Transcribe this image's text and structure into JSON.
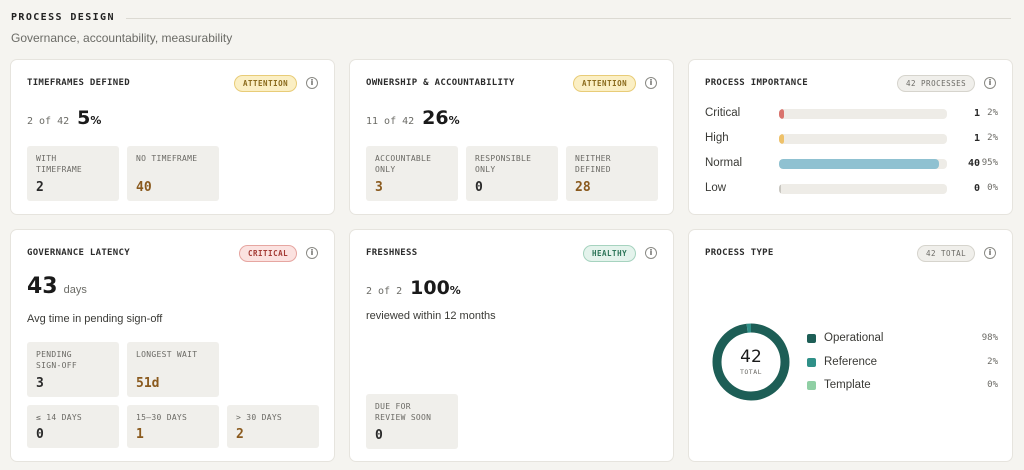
{
  "header": {
    "title": "PROCESS DESIGN",
    "subtitle": "Governance, accountability, measurability"
  },
  "timeframes": {
    "title": "TIMEFRAMES DEFINED",
    "badge": "ATTENTION",
    "count_of": "2 of 42",
    "percent": "5",
    "tiles": [
      {
        "label": "WITH\nTIMEFRAME",
        "value": "2"
      },
      {
        "label": "NO TIMEFRAME",
        "value": "40"
      }
    ]
  },
  "ownership": {
    "title": "OWNERSHIP & ACCOUNTABILITY",
    "badge": "ATTENTION",
    "count_of": "11 of 42",
    "percent": "26",
    "tiles": [
      {
        "label": "ACCOUNTABLE\nONLY",
        "value": "3"
      },
      {
        "label": "RESPONSIBLE\nONLY",
        "value": "0"
      },
      {
        "label": "NEITHER\nDEFINED",
        "value": "28"
      }
    ]
  },
  "importance": {
    "title": "PROCESS IMPORTANCE",
    "badge": "42 PROCESSES",
    "rows": [
      {
        "label": "Critical",
        "count": "1",
        "pct": "2%",
        "fraction": 0.02,
        "color": "#d9736d"
      },
      {
        "label": "High",
        "count": "1",
        "pct": "2%",
        "fraction": 0.02,
        "color": "#eec169"
      },
      {
        "label": "Normal",
        "count": "40",
        "pct": "95%",
        "fraction": 0.95,
        "color": "#8fc1d1"
      },
      {
        "label": "Low",
        "count": "0",
        "pct": "0%",
        "fraction": 0.0,
        "color": "#c9c7c1"
      }
    ]
  },
  "latency": {
    "title": "GOVERNANCE LATENCY",
    "badge": "CRITICAL",
    "value": "43",
    "unit": "days",
    "description": "Avg time in pending sign-off",
    "tiles_top": [
      {
        "label": "PENDING\nSIGN-OFF",
        "value": "3"
      },
      {
        "label": "LONGEST WAIT",
        "value": "51d"
      }
    ],
    "tiles_bottom": [
      {
        "label": "≤ 14 DAYS",
        "value": "0"
      },
      {
        "label": "15–30 DAYS",
        "value": "1"
      },
      {
        "label": "> 30 DAYS",
        "value": "2"
      }
    ]
  },
  "freshness": {
    "title": "FRESHNESS",
    "badge": "HEALTHY",
    "count_of": "2 of 2",
    "percent": "100",
    "description": "reviewed within 12 months",
    "tile": {
      "label": "DUE FOR\nREVIEW SOON",
      "value": "0"
    }
  },
  "process_type": {
    "title": "PROCESS TYPE",
    "badge": "42 TOTAL",
    "center_value": "42",
    "center_label": "TOTAL",
    "legend": [
      {
        "label": "Operational",
        "count": "41",
        "pct": "98%",
        "fraction": 0.98,
        "color": "#1d5e56"
      },
      {
        "label": "Reference",
        "count": "1",
        "pct": "2%",
        "fraction": 0.02,
        "color": "#2f9088"
      },
      {
        "label": "Template",
        "count": "0",
        "pct": "0%",
        "fraction": 0.0,
        "color": "#8fcfa4"
      }
    ]
  }
}
